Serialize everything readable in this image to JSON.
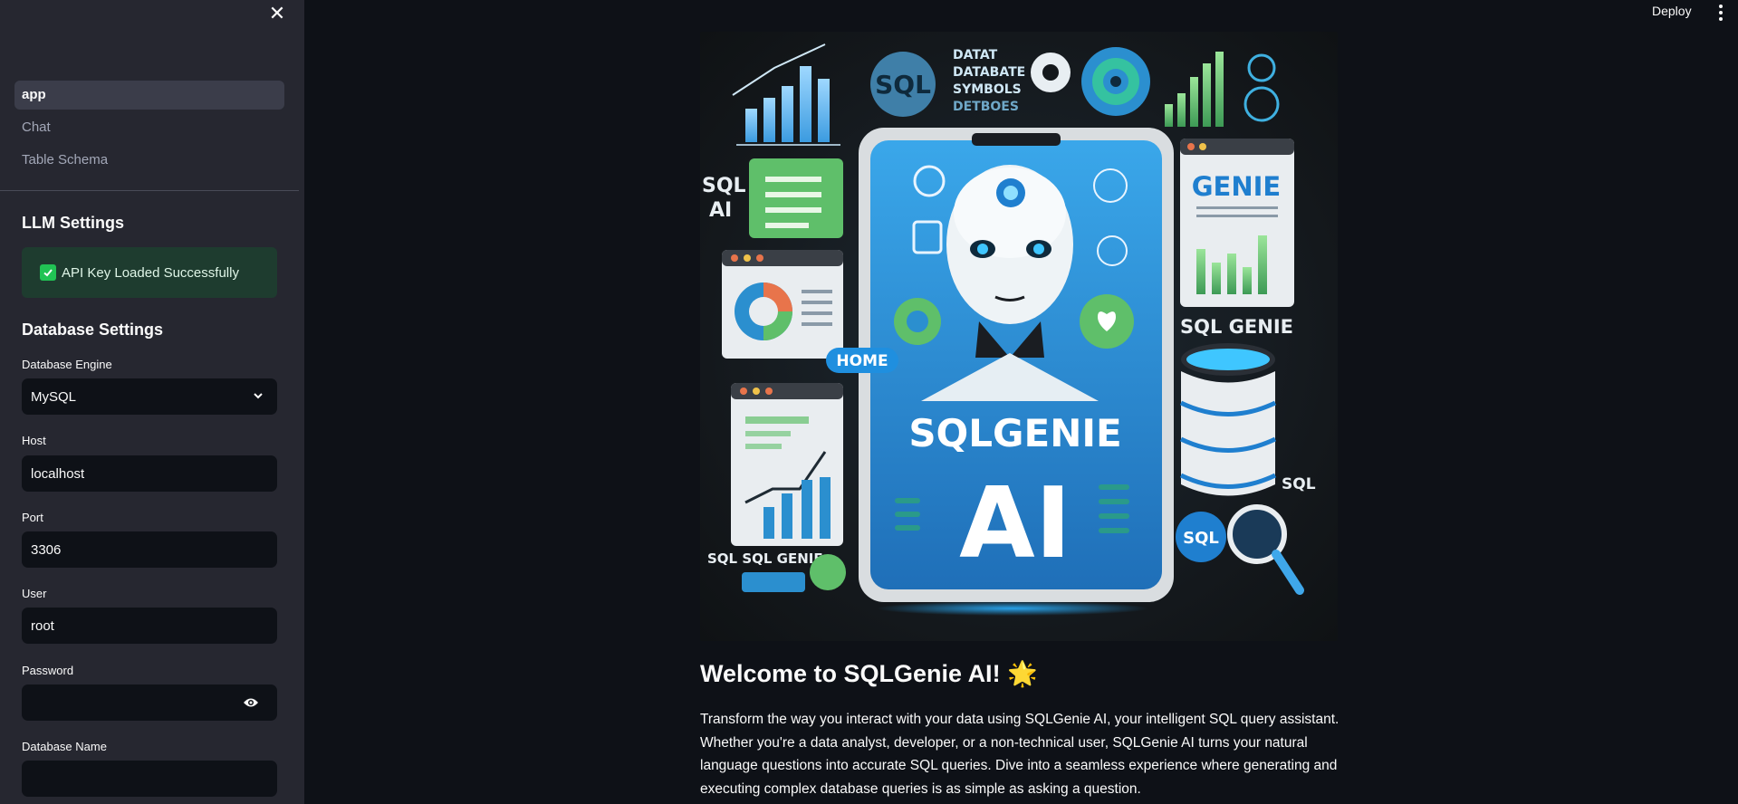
{
  "sidebar": {
    "nav_items": [
      {
        "label": "app",
        "active": true
      },
      {
        "label": "Chat",
        "active": false
      },
      {
        "label": "Table Schema",
        "active": false
      }
    ],
    "llm_settings": {
      "title": "LLM Settings",
      "status": "API Key Loaded Successfully"
    },
    "database_settings": {
      "title": "Database Settings",
      "engine_label": "Database Engine",
      "engine_value": "MySQL",
      "host_label": "Host",
      "host_value": "localhost",
      "port_label": "Port",
      "port_value": "3306",
      "user_label": "User",
      "user_value": "root",
      "password_label": "Password",
      "password_value": "",
      "dbname_label": "Database Name",
      "dbname_value": ""
    }
  },
  "header": {
    "deploy_label": "Deploy"
  },
  "main": {
    "hero": {
      "top_text": [
        "DATAT",
        "DATABATE",
        "SYMBOLS",
        "DETBOES"
      ],
      "sql_badge": "SQL",
      "sql_ai": [
        "SQL",
        "AI"
      ],
      "genie_card": "GENIE",
      "sql_genie_label": "SQL GENIE",
      "home_badge": "HOME",
      "phone_title": "SQLGENIE",
      "phone_subtitle": "AI",
      "sql_side": "SQL",
      "sql_circle": "SQL",
      "sql_bottom": "SQL  SQL GENIE"
    },
    "welcome_title": "Welcome to SQLGenie AI! 🌟",
    "intro_lines": [
      "Transform the way you interact with your data using SQLGenie AI, your intelligent SQL query assistant.",
      "Whether you're a data analyst, developer, or a non-technical user, SQLGenie AI turns your natural",
      "language questions into accurate SQL queries. Dive into a seamless experience where generating and",
      "executing complex database queries is as simple as asking a question."
    ]
  },
  "colors": {
    "sidebar_bg": "#262730",
    "main_bg": "#0e1117",
    "success_bg": "#1e3c2f",
    "success_check": "#21c354",
    "hero_blue": "#2d8fd8"
  }
}
